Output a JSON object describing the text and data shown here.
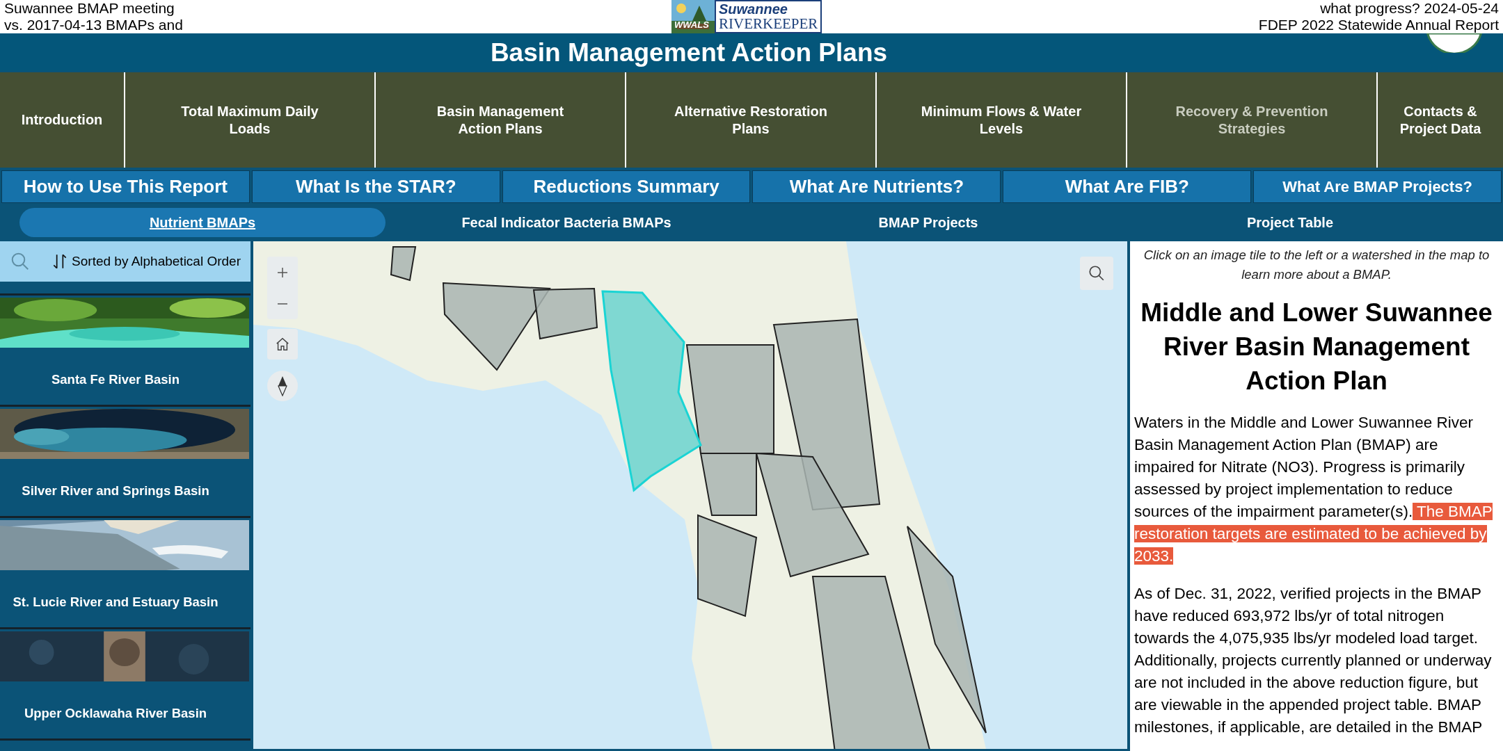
{
  "captions": {
    "left": [
      "Suwannee BMAP meeting",
      "vs. 2017-04-13 BMAPs and"
    ],
    "right": [
      "what progress? 2024-05-24",
      "FDEP 2022 Statewide Annual Report"
    ]
  },
  "logo": {
    "badge": "WWALS",
    "top": "Suwannee",
    "bottom": "RIVERKEEPER"
  },
  "header": {
    "title": "Basin Management Action Plans"
  },
  "main_nav": [
    {
      "label": "Introduction",
      "dimmed": false
    },
    {
      "label": "Total Maximum Daily Loads",
      "dimmed": false
    },
    {
      "label": "Basin Management Action Plans",
      "dimmed": false
    },
    {
      "label": "Alternative Restoration Plans",
      "dimmed": false
    },
    {
      "label": "Minimum Flows & Water Levels",
      "dimmed": false
    },
    {
      "label": "Recovery & Prevention Strategies",
      "dimmed": true
    },
    {
      "label": "Contacts & Project Data",
      "dimmed": false
    }
  ],
  "topic_buttons": [
    {
      "label": "How to Use This Report"
    },
    {
      "label": "What Is the STAR?"
    },
    {
      "label": "Reductions Summary"
    },
    {
      "label": "What Are Nutrients?"
    },
    {
      "label": "What Are FIB?"
    },
    {
      "label": "What Are BMAP Projects?"
    }
  ],
  "tabs": [
    {
      "label": "Nutrient BMAPs",
      "selected": true
    },
    {
      "label": "Fecal Indicator Bacteria BMAPs",
      "selected": false
    },
    {
      "label": "BMAP Projects",
      "selected": false
    },
    {
      "label": "Project Table",
      "selected": false
    }
  ],
  "sidebar": {
    "sort_label": "Sorted by Alphabetical Order",
    "items": [
      {
        "title": "Santa Fe River Basin"
      },
      {
        "title": "Silver River and Springs Basin"
      },
      {
        "title": "St. Lucie River and Estuary Basin"
      },
      {
        "title": "Upper Ocklawaha River Basin"
      }
    ]
  },
  "panel": {
    "hint": "Click on an image tile to the left or a watershed in the map to learn more about a BMAP.",
    "title": "Middle and Lower Suwannee River Basin Management Action Plan",
    "paragraphs": [
      [
        {
          "text": "Waters in the Middle and Lower Suwannee River Basin Management Action Plan (BMAP) are impaired for Nitrate (NO3). Progress is primarily assessed by project implementation to reduce sources of the impairment parameter(s).",
          "highlighted": false
        },
        {
          "text": " The BMAP restoration targets are estimated to be achieved by 2033.",
          "highlighted": true
        }
      ],
      [
        {
          "text": "As of Dec. 31, 2022, verified projects in the BMAP have reduced 693,972 lbs/yr of total nitrogen towards the 4,075,935 lbs/yr modeled load target. Additionally, projects currently planned or underway are not included in the above reduction figure, but are viewable in the appended project table. BMAP milestones, if applicable, are detailed in the BMAP",
          "highlighted": false
        }
      ]
    ]
  }
}
